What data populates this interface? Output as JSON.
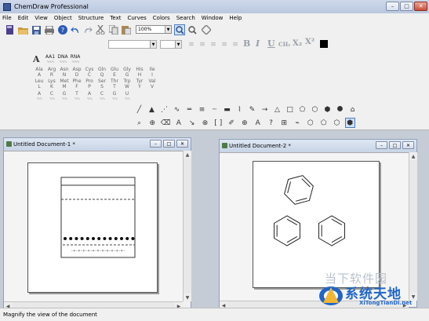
{
  "app": {
    "title": "ChemDraw Professional",
    "window_controls": {
      "minimize": "–",
      "maximize": "□",
      "close": "✕"
    }
  },
  "menu": [
    "File",
    "Edit",
    "View",
    "Object",
    "Structure",
    "Text",
    "Curves",
    "Colors",
    "Search",
    "Window",
    "Help"
  ],
  "toolbar": {
    "zoom": "100%",
    "text_buttons": {
      "bold": "B",
      "italic": "I",
      "underline": "U",
      "ch2": "CH₂",
      "sub": "X₂",
      "sup": "X²"
    },
    "template_headers": [
      {
        "label": "AA1",
        "sub": ""
      },
      {
        "label": "DNA",
        "sub": ""
      },
      {
        "label": "RNA",
        "sub": ""
      }
    ],
    "amino_row1": [
      "Ala",
      "Arg",
      "Asn",
      "Asp",
      "Cys",
      "Gln",
      "Glu",
      "Gly",
      "His",
      "Ile"
    ],
    "amino_row1_codes": [
      "A",
      "R",
      "N",
      "D",
      "C",
      "Q",
      "E",
      "G",
      "H",
      "I"
    ],
    "amino_row2": [
      "Leu",
      "Lys",
      "Met",
      "Phe",
      "Pro",
      "Ser",
      "Thr",
      "Trp",
      "Tyr",
      "Val"
    ],
    "amino_row2_codes": [
      "L",
      "K",
      "M",
      "F",
      "P",
      "S",
      "T",
      "W",
      "Y",
      "V"
    ],
    "nucleotides": [
      "A",
      "C",
      "G",
      "T",
      "A",
      "C",
      "G",
      "U"
    ],
    "icons_row1": [
      "new-document-icon",
      "open-folder-icon",
      "save-icon",
      "print-icon",
      "help-icon",
      "undo-icon",
      "redo-icon",
      "cut-icon",
      "copy-icon",
      "paste-icon"
    ],
    "icons_zoom": [
      "zoom-in-icon",
      "zoom-out-icon",
      "center-icon"
    ],
    "draw_row1": [
      "bond-icon",
      "wedge-bond-icon",
      "hash-bond-icon",
      "wavy-bond-icon",
      "double-bond-icon",
      "triple-bond-icon",
      "dashed-bond-icon",
      "bold-bond-icon",
      "chain-icon",
      "pen-icon",
      "arrow-icon",
      "cyclopropane-icon",
      "cyclobutane-icon",
      "pentagon-icon",
      "hexagon-icon",
      "heptagon-icon",
      "octagon-icon",
      "house-icon"
    ],
    "draw_row2": [
      "lasso-icon",
      "structure-perspective-icon",
      "eraser-icon",
      "text-icon",
      "arrow-tool-icon",
      "orbital-icon",
      "bracket-icon",
      "pen-tool-icon",
      "charge-icon",
      "element-icon",
      "query-icon",
      "table-icon",
      "chair-icon",
      "benzene-icon",
      "cyclopentadiene-icon",
      "cyclohexane-icon",
      "benzene-ring-icon"
    ]
  },
  "documents": [
    {
      "title": "Untitled Document-1 *"
    },
    {
      "title": "Untitled Document-2 *"
    }
  ],
  "status": {
    "text": "Magnify the view of the document"
  },
  "watermark": {
    "faint": "当下软件园",
    "cn": "系统天地",
    "en": "XiTongTianDi.net"
  }
}
